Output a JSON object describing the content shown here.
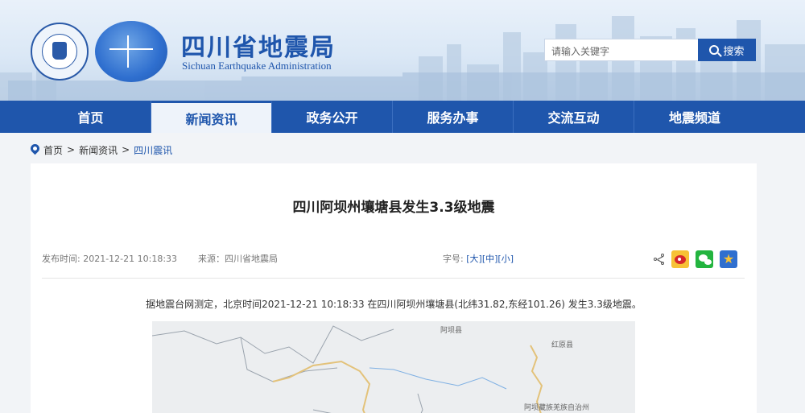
{
  "header": {
    "title": "四川省地震局",
    "subtitle": "Sichuan Earthquake Administration",
    "search_placeholder": "请输入关键字",
    "search_button": "搜索"
  },
  "nav": {
    "items": [
      "首页",
      "新闻资讯",
      "政务公开",
      "服务办事",
      "交流互动",
      "地震频道"
    ],
    "active_index": 1
  },
  "breadcrumb": {
    "items": [
      "首页",
      "新闻资讯",
      "四川震讯"
    ],
    "separator": ">"
  },
  "article": {
    "title": "四川阿坝州壤塘县发生3.3级地震",
    "publish_time": "发布时间: 2021-12-21 10:18:33",
    "source": "来源：四川省地震局",
    "font_label": "字号:",
    "font_large": "[大]",
    "font_medium": "[中]",
    "font_small": "[小]",
    "paragraph": "据地震台网测定，北京时间2021-12-21 10:18:33 在四川阿坝州壤塘县(北纬31.82,东经101.26) 发生3.3级地震。"
  },
  "map": {
    "labels": [
      "阿坝县",
      "红原县",
      "阿坝藏族羌族自治州"
    ]
  },
  "colors": {
    "brand": "#1f56ac",
    "nav_bg": "#1f56ac",
    "card_bg": "#ffffff",
    "page_bg": "#f2f4f7"
  },
  "icons": {
    "search": "search-icon",
    "location": "pin-icon",
    "share": "share-icon",
    "weibo": "weibo-icon",
    "wechat": "wechat-icon",
    "favorite": "star-icon"
  }
}
